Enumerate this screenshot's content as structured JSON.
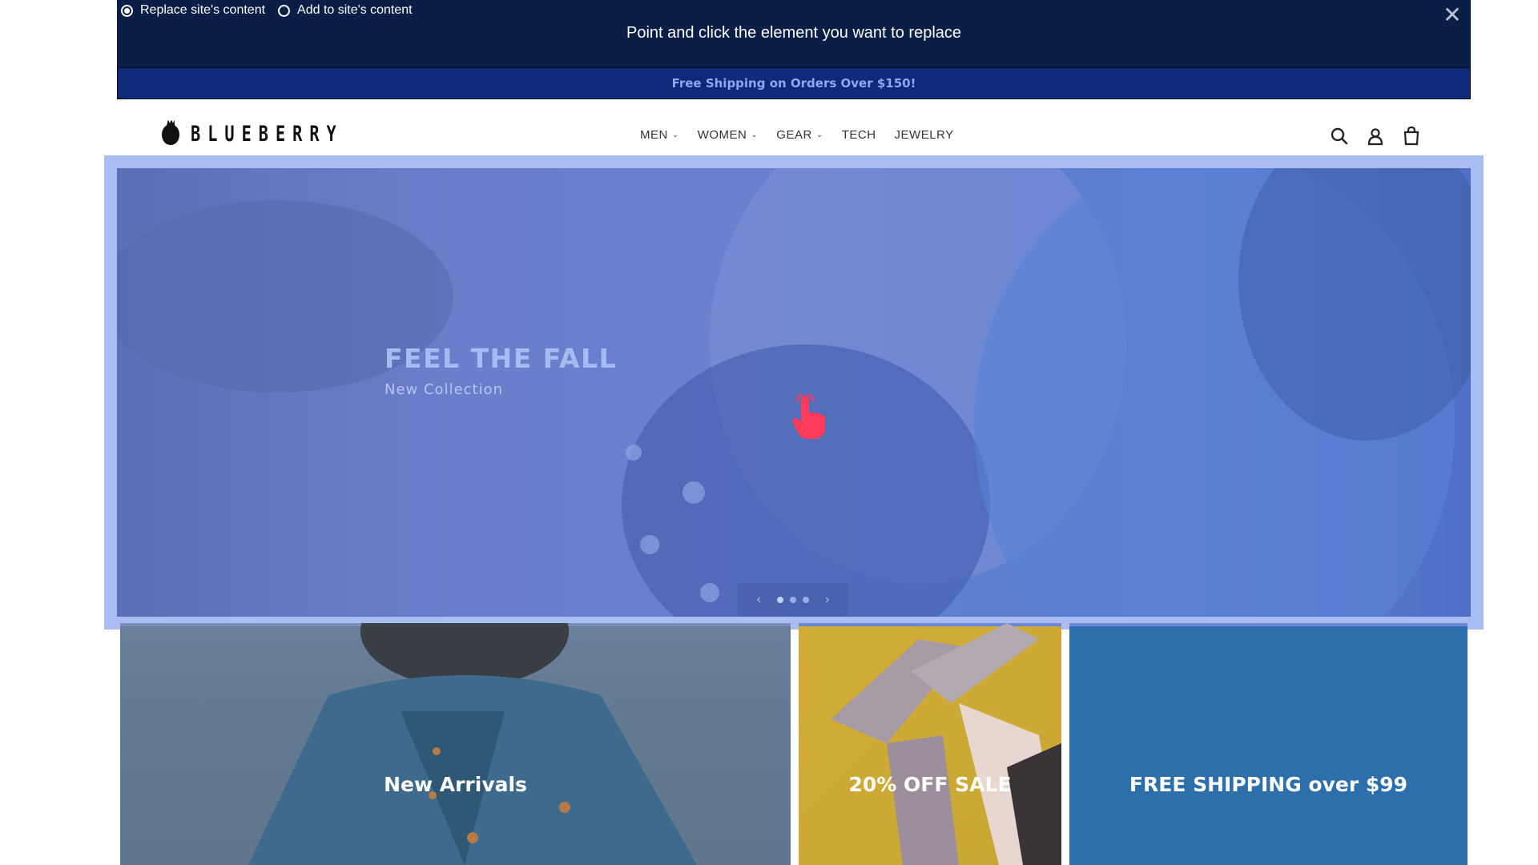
{
  "editor_bar": {
    "modes": [
      {
        "label": "Replace site's content",
        "selected": true
      },
      {
        "label": "Add to site's content",
        "selected": false
      }
    ],
    "instruction": "Point and click the element you want to replace",
    "close_icon": "close-icon"
  },
  "announcement": {
    "text": "Free Shipping on Orders Over $150!"
  },
  "header": {
    "logo_text": "BLUEBERRY",
    "nav": [
      {
        "label": "MEN",
        "has_dropdown": true
      },
      {
        "label": "WOMEN",
        "has_dropdown": true
      },
      {
        "label": "GEAR",
        "has_dropdown": true
      },
      {
        "label": "TECH",
        "has_dropdown": false
      },
      {
        "label": "JEWELRY",
        "has_dropdown": false
      }
    ],
    "icons": [
      "search-icon",
      "account-icon",
      "cart-icon"
    ]
  },
  "hero": {
    "heading": "FEEL THE FALL",
    "subheading": "New Collection",
    "slide_count": 3,
    "active_slide": 1
  },
  "tiles": [
    {
      "label": "New Arrivals"
    },
    {
      "label": "20% OFF SALE"
    },
    {
      "label": "FREE SHIPPING over $99"
    }
  ],
  "colors": {
    "editor_bg": "#0b1e45",
    "announcement_bg": "#0f2a78",
    "selection_highlight": "#a9bdf2",
    "cursor": "#ff3b5c"
  }
}
